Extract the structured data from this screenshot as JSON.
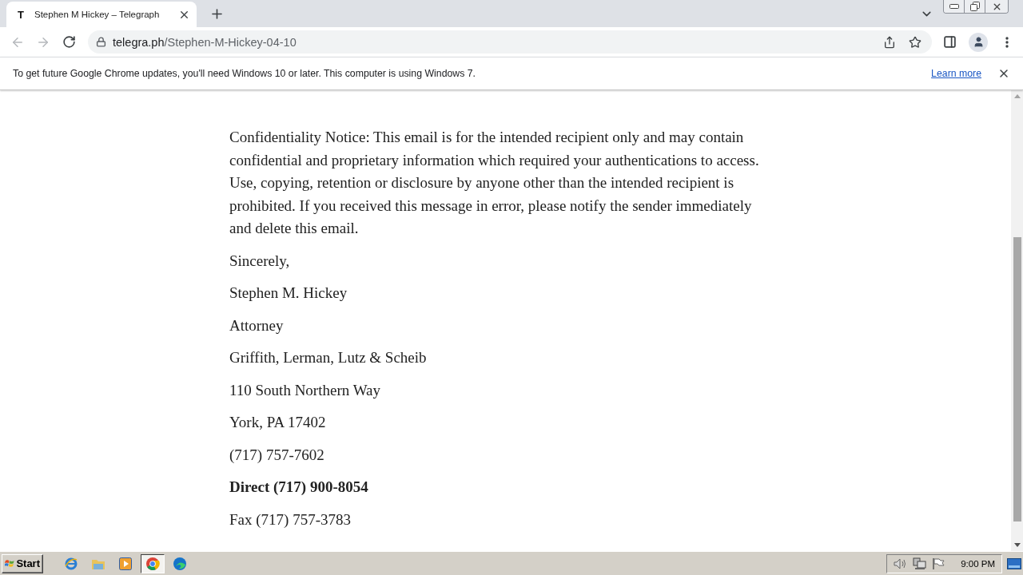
{
  "browser": {
    "tabs": [
      {
        "favicon": "T",
        "title": "Stephen M Hickey – Telegraph",
        "selected": true
      }
    ],
    "address_bar": {
      "domain": "telegra.ph",
      "path": "/Stephen-M-Hickey-04-10"
    }
  },
  "infobar": {
    "message": "To get future Google Chrome updates, you'll need Windows 10 or later. This computer is using Windows 7.",
    "link": "Learn more"
  },
  "article": {
    "paragraphs": [
      {
        "text": "Confidentiality Notice: This email is for the intended recipient only and may contain confidential and proprietary information which required your authentications to access. Use, copying, retention or disclosure by anyone other than the intended recipient is prohibited. If you received this message in error, please notify the sender immediately and delete this email.",
        "bold": false
      },
      {
        "text": "Sincerely,",
        "bold": false
      },
      {
        "text": "Stephen M. Hickey",
        "bold": false
      },
      {
        "text": "Attorney",
        "bold": false
      },
      {
        "text": "Griffith, Lerman, Lutz & Scheib",
        "bold": false
      },
      {
        "text": "110 South Northern Way",
        "bold": false
      },
      {
        "text": "York, PA 17402",
        "bold": false
      },
      {
        "text": "(717) 757-7602",
        "bold": false
      },
      {
        "text": "Direct (717) 900-8054",
        "bold": true
      },
      {
        "text": "Fax (717) 757-3783",
        "bold": false
      }
    ]
  },
  "taskbar": {
    "start": "Start",
    "apps": [
      {
        "kind": "ie",
        "selected": false
      },
      {
        "kind": "folder",
        "selected": false
      },
      {
        "kind": "media",
        "selected": false
      },
      {
        "kind": "chrome",
        "selected": true
      },
      {
        "kind": "edge",
        "selected": false
      }
    ],
    "clock": "9:00 PM"
  }
}
